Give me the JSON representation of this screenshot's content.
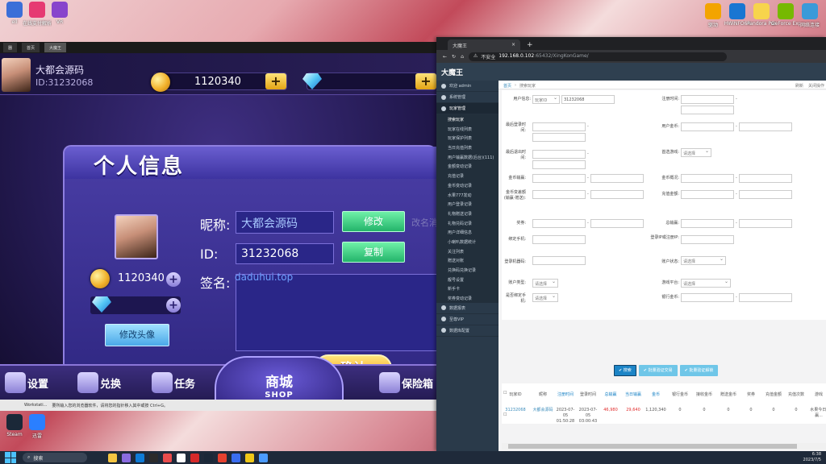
{
  "desktop_left": [
    {
      "label": "ell",
      "color": "#3b6fd8"
    },
    {
      "label": "在线支付解析器",
      "color": "#e63a72"
    },
    {
      "label": "VR",
      "color": "#8844cc"
    }
  ],
  "desktop_right": [
    {
      "label": "驱动",
      "color": "#f3a400"
    },
    {
      "label": "HWiNFO64",
      "color": "#1976d2"
    },
    {
      "label": "Pandora Pandora 16",
      "color": "#f7d44c"
    },
    {
      "label": "GeForce Experience",
      "color": "#76b900"
    },
    {
      "label": "网络连接",
      "color": "#3a9ad9"
    }
  ],
  "desktop_bottom": [
    {
      "label": "Steam",
      "color": "#1b2838"
    },
    {
      "label": "迅雷",
      "color": "#2a7fff"
    }
  ],
  "game": {
    "window_tabs": [
      "器",
      "首页",
      "大魔王"
    ],
    "player_name": "大都会源码",
    "player_id_label": "ID:31232068",
    "coins": "1120340",
    "panel_title": "个人信息",
    "nickname_label": "昵称:",
    "nickname_value": "大都会源码",
    "modify_btn": "修改",
    "nickname_hint": "改名消耗",
    "id_label": "ID:",
    "id_value": "31232068",
    "copy_btn": "复制",
    "signature_label": "签名:",
    "signature_placeholder": "daduhui.top",
    "change_avatar_btn": "修改头像",
    "confirm_btn": "确认",
    "nav_settings": "设置",
    "nav_exchange": "兑换",
    "nav_task": "任务",
    "nav_shop": "商城",
    "nav_shop_sub": "SHOP",
    "nav_bank": "保险箱",
    "status_text": "Workstati...",
    "status_hint": "要所输入您的浏览器软件，请将您的指针移入其中或按 Ctrl+G。"
  },
  "browser": {
    "tab_title": "大魔王",
    "tab_close": "×",
    "new_tab": "+",
    "insecure": "不安全",
    "url_host": "192.168.0.102",
    "url_path": ":65432/XingKonGame/",
    "app_title": "大魔王"
  },
  "sidebar": {
    "welcome": "欢迎 admin",
    "system": "系统管理",
    "player_mgmt": "玩家管理",
    "search_player": "搜索玩家",
    "items": [
      "玩家在线列表",
      "玩家保护列表",
      "当日充值列表",
      "用户输赢数据(后台)(111)",
      "金额变动记录",
      "充值记录",
      "金币变动记录",
      "水果777发动",
      "用户登录记录",
      "礼物赠送记录",
      "礼物兑码记录",
      "用户详细信息",
      "小喇叭数据统计",
      "关注列表",
      "赠送对账",
      "兑换码兑换记录",
      "靓号设置",
      "新手卡",
      "奖券变动记录"
    ],
    "data_stats": "数据报表",
    "vip": "至尊VIP",
    "data_config": "数据库配置"
  },
  "crumb": {
    "home": "首页",
    "current": "搜索玩家",
    "refresh": "刷新",
    "close_ops": "关闭操作"
  },
  "form": {
    "user_info_label": "用户信息:",
    "user_info_select": "玩家ID",
    "user_info_value": "31232068",
    "register_time_label": "注册时间:",
    "last_login_label": "最后登录时间:",
    "user_coin_label": "用户金币:",
    "last_logout_label": "最后退出时间:",
    "first_game_label": "首选游戏:",
    "select_placeholder": "请选择",
    "coin_win_label": "金币输赢:",
    "coin_over_label": "金币概况:",
    "coin_change_label": "金币变差额(输赢·赠送):",
    "recharge_amount_label": "充值金额:",
    "ticket_label": "奖券:",
    "total_win_label": "总输赢:",
    "bind_phone_label": "绑定手机:",
    "login_ip_label": "登录IP或注册IP:",
    "login_machine_label": "登录机器码:",
    "account_status_label": "账户状态:",
    "account_type_label": "账户类型:",
    "game_platform_label": "游戏平台:",
    "is_bind_label": "是否绑定手机:",
    "bank_coin_label": "银行金币:"
  },
  "buttons": {
    "search": "搜索",
    "batch_verify": "批量验证交易",
    "batch_unlock": "批量验证解锁"
  },
  "table": {
    "headers": [
      "玩家ID",
      "昵称",
      "注册时间",
      "登录时间",
      "总输赢",
      "当日输赢",
      "金币",
      "银行金币",
      "接收金币",
      "赠送金币",
      "奖券",
      "充值金额",
      "充值次数",
      "游戏"
    ],
    "row": [
      "31232068",
      "大都会源码",
      "2023-07-05 01:50:28",
      "2023-07-05 03:00:43",
      "46,980",
      "29,640",
      "1,120,340",
      "0",
      "0",
      "0",
      "0",
      "0",
      "0",
      "水果今日·赢..."
    ]
  },
  "taskbar": {
    "search": "搜索",
    "time": "6:38",
    "date": "2023/7/5"
  }
}
